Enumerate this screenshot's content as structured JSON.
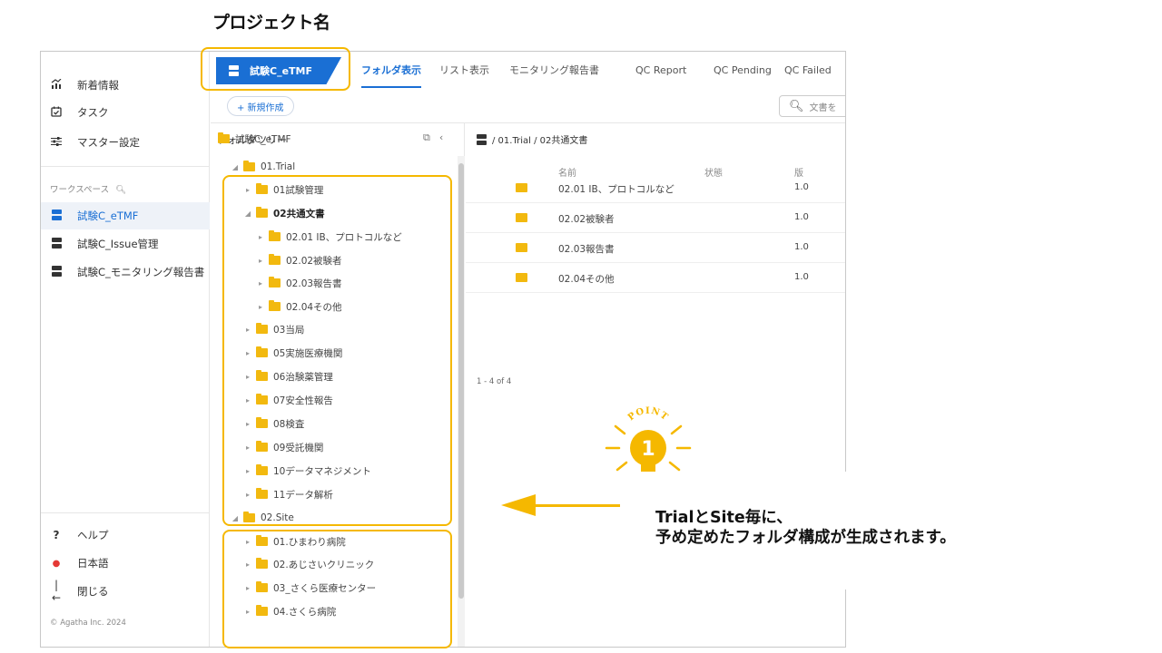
{
  "project_label": "プロジェクト名",
  "sidebar": {
    "top_items": [
      {
        "label": "新着情報",
        "icon": "chart-icon"
      },
      {
        "label": "タスク",
        "icon": "calendar-check-icon"
      },
      {
        "label": "マスター設定",
        "icon": "sliders-icon"
      }
    ],
    "workspace_header": "ワークスペース",
    "workspaces": [
      {
        "label": "試験C_eTMF",
        "active": true
      },
      {
        "label": "試験C_Issue管理",
        "active": false
      },
      {
        "label": "試験C_モニタリング報告書",
        "active": false
      }
    ],
    "bottom_items": [
      {
        "label": "ヘルプ",
        "icon": "question-icon"
      },
      {
        "label": "日本語",
        "icon": "language-dot-icon"
      },
      {
        "label": "閉じる",
        "icon": "collapse-icon"
      }
    ],
    "copyright": "© Agatha Inc. 2024"
  },
  "tabs": {
    "project_tab": "試験C_eTMF",
    "items": [
      "フォルダ表示",
      "リスト表示",
      "モニタリング報告書",
      "QC Report",
      "QC Pending",
      "QC Failed"
    ]
  },
  "toolbar": {
    "new_button": "+  新規作成",
    "search_placeholder": "文書を"
  },
  "tree": {
    "title": "フォルダツリー",
    "rows": [
      {
        "label": "試験C_eTMF",
        "indent": 0,
        "arrow": "",
        "bold": false
      },
      {
        "label": "01.Trial",
        "indent": 1,
        "arrow": "◢",
        "bold": false
      },
      {
        "label": "01試験管理",
        "indent": 2,
        "arrow": "▸",
        "bold": false
      },
      {
        "label": "02共通文書",
        "indent": 2,
        "arrow": "◢",
        "bold": true
      },
      {
        "label": "02.01 IB、プロトコルなど",
        "indent": 3,
        "arrow": "▸",
        "bold": false
      },
      {
        "label": "02.02被験者",
        "indent": 3,
        "arrow": "▸",
        "bold": false
      },
      {
        "label": "02.03報告書",
        "indent": 3,
        "arrow": "▸",
        "bold": false
      },
      {
        "label": "02.04その他",
        "indent": 3,
        "arrow": "▸",
        "bold": false
      },
      {
        "label": "03当局",
        "indent": 2,
        "arrow": "▸",
        "bold": false
      },
      {
        "label": "05実施医療機関",
        "indent": 2,
        "arrow": "▸",
        "bold": false
      },
      {
        "label": "06治験薬管理",
        "indent": 2,
        "arrow": "▸",
        "bold": false
      },
      {
        "label": "07安全性報告",
        "indent": 2,
        "arrow": "▸",
        "bold": false
      },
      {
        "label": "08検査",
        "indent": 2,
        "arrow": "▸",
        "bold": false
      },
      {
        "label": "09受託機関",
        "indent": 2,
        "arrow": "▸",
        "bold": false
      },
      {
        "label": "10データマネジメント",
        "indent": 2,
        "arrow": "▸",
        "bold": false
      },
      {
        "label": "11データ解析",
        "indent": 2,
        "arrow": "▸",
        "bold": false
      },
      {
        "label": "02.Site",
        "indent": 1,
        "arrow": "◢",
        "bold": false
      },
      {
        "label": "01.ひまわり病院",
        "indent": 2,
        "arrow": "▸",
        "bold": false
      },
      {
        "label": "02.あじさいクリニック",
        "indent": 2,
        "arrow": "▸",
        "bold": false
      },
      {
        "label": "03_さくら医療センター",
        "indent": 2,
        "arrow": "▸",
        "bold": false
      },
      {
        "label": "04.さくら病院",
        "indent": 2,
        "arrow": "▸",
        "bold": false
      }
    ]
  },
  "list": {
    "breadcrumb": "/ 01.Trial / 02共通文書",
    "columns": {
      "name": "名前",
      "status": "状態",
      "version": "版"
    },
    "rows": [
      {
        "name": "02.01 IB、プロトコルなど",
        "version": "1.0"
      },
      {
        "name": "02.02被験者",
        "version": "1.0"
      },
      {
        "name": "02.03報告書",
        "version": "1.0"
      },
      {
        "name": "02.04その他",
        "version": "1.0"
      }
    ],
    "pager": "1 - 4 of 4"
  },
  "annotation": {
    "badge_text": "POINT",
    "badge_number": "1",
    "line1": "TrialとSite毎に、",
    "line2": "予め定めたフォルダ構成が生成されます。",
    "accent": "#f5b800"
  }
}
